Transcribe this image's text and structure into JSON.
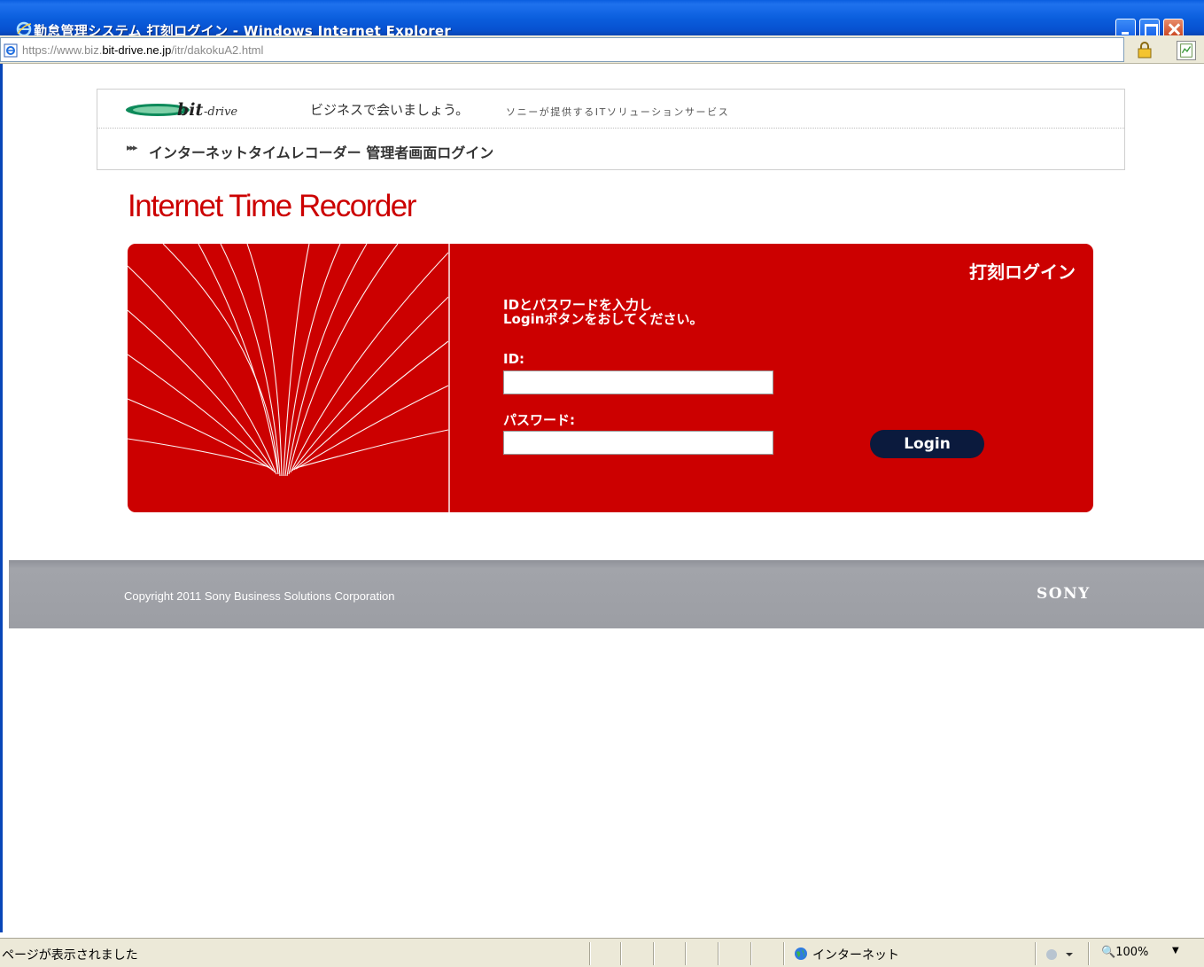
{
  "window": {
    "title": "勤怠管理システム 打刻ログイン - Windows Internet Explorer"
  },
  "address_bar": {
    "url_prefix": "https://www.biz.",
    "url_host": "bit-drive.ne.jp",
    "url_path": "/itr/dakokuA2.html"
  },
  "header": {
    "brand": "bit-drive",
    "tagline": "ビジネスで会いましょう。",
    "tagline_sub": "ソニーが提供するITソリューションサービス",
    "arrows": "▸▸▸",
    "admin_login_title": "インターネットタイムレコーダー 管理者画面ログイン"
  },
  "main": {
    "app_title": "Internet Time Recorder",
    "panel_heading": "打刻ログイン",
    "instruction_line1": "IDとパスワードを入力し",
    "instruction_line2": "Loginボタンをおしてください。",
    "id_label": "ID:",
    "id_value": "",
    "password_label": "パスワード:",
    "password_value": "",
    "login_button": "Login"
  },
  "footer": {
    "copyright": "Copyright 2011 Sony Business Solutions Corporation",
    "logo": "SONY"
  },
  "status_bar": {
    "status": "ページが表示されました",
    "zone": "インターネット",
    "zoom": "100%"
  },
  "colors": {
    "accent_red": "#cc0000",
    "login_button": "#0b1a3d",
    "footer_gray": "#9c9ea4"
  }
}
